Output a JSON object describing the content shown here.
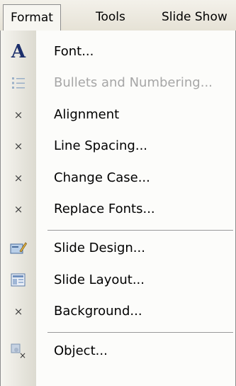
{
  "menubar": {
    "items": [
      {
        "label": "Format",
        "active": true
      },
      {
        "label": "Tools",
        "active": false
      },
      {
        "label": "Slide Show",
        "active": false
      }
    ]
  },
  "menu": {
    "items": [
      {
        "label": "Font...",
        "icon": "font-a-icon",
        "enabled": true
      },
      {
        "label": "Bullets and Numbering...",
        "icon": "bullets-icon",
        "enabled": false
      },
      {
        "label": "Alignment",
        "icon": "x-marker-icon",
        "enabled": true
      },
      {
        "label": "Line Spacing...",
        "icon": "x-marker-icon",
        "enabled": true
      },
      {
        "label": "Change Case...",
        "icon": "x-marker-icon",
        "enabled": true
      },
      {
        "label": "Replace Fonts...",
        "icon": "x-marker-icon",
        "enabled": true
      },
      {
        "label": "Slide Design...",
        "icon": "slide-design-icon",
        "enabled": true
      },
      {
        "label": "Slide Layout...",
        "icon": "slide-layout-icon",
        "enabled": true
      },
      {
        "label": "Background...",
        "icon": "x-marker-icon",
        "enabled": true
      },
      {
        "label": "Object...",
        "icon": "object-icon",
        "enabled": true
      }
    ]
  },
  "colors": {
    "menu_background": "#fcfcfa",
    "separator": "#9a9a9a",
    "disabled_text": "#a6a6a6"
  }
}
